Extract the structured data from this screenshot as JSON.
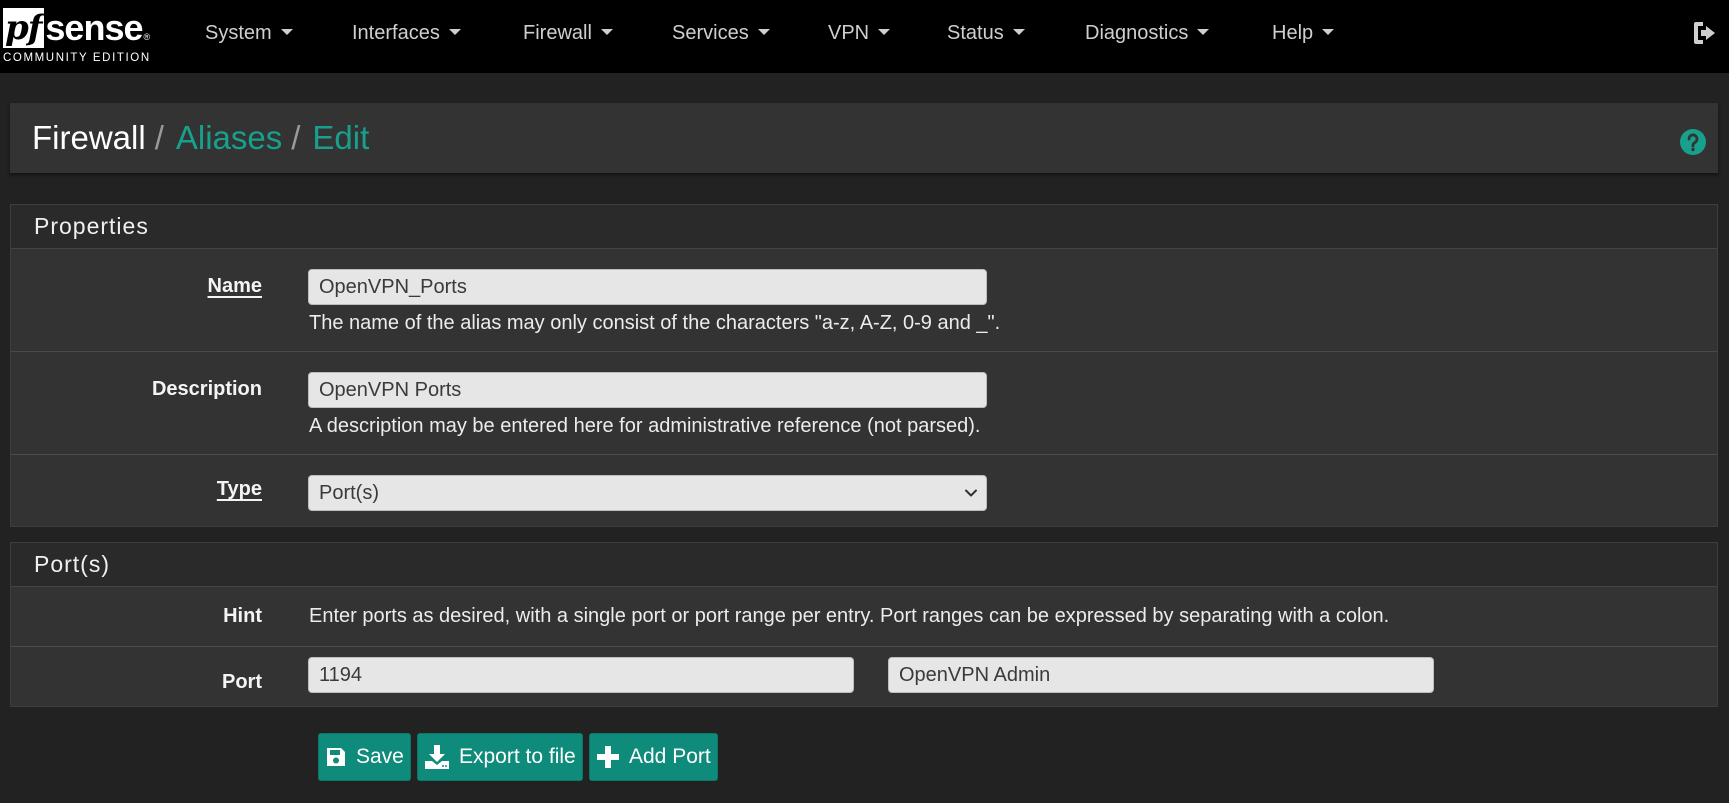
{
  "brand": {
    "logo_pf": "pf",
    "logo_sense": "sense",
    "logo_reg": "®",
    "edition": "COMMUNITY EDITION"
  },
  "nav": {
    "items": [
      {
        "label": "System"
      },
      {
        "label": "Interfaces"
      },
      {
        "label": "Firewall"
      },
      {
        "label": "Services"
      },
      {
        "label": "VPN"
      },
      {
        "label": "Status"
      },
      {
        "label": "Diagnostics"
      },
      {
        "label": "Help"
      }
    ],
    "logout_icon": "sign-out-icon"
  },
  "breadcrumb": {
    "root": "Firewall",
    "sep": "/",
    "level1": "Aliases",
    "level2": "Edit",
    "help_icon": "question-circle-icon"
  },
  "properties": {
    "heading": "Properties",
    "name": {
      "label": "Name",
      "value": "OpenVPN_Ports",
      "help": "The name of the alias may only consist of the characters \"a-z, A-Z, 0-9 and _\"."
    },
    "description": {
      "label": "Description",
      "value": "OpenVPN Ports",
      "help": "A description may be entered here for administrative reference (not parsed)."
    },
    "type": {
      "label": "Type",
      "selected": "Port(s)"
    }
  },
  "ports": {
    "heading": "Port(s)",
    "hint_label": "Hint",
    "hint_text": "Enter ports as desired, with a single port or port range per entry. Port ranges can be expressed by separating with a colon.",
    "port_label": "Port",
    "entries": [
      {
        "port": "1194",
        "description": "OpenVPN Admin"
      }
    ]
  },
  "actions": {
    "save": "Save",
    "export": "Export to file",
    "add_port": "Add Port"
  },
  "colors": {
    "accent": "#17a08c",
    "button": "#0f8b7c",
    "navbar": "#000000",
    "panel": "#333333"
  }
}
